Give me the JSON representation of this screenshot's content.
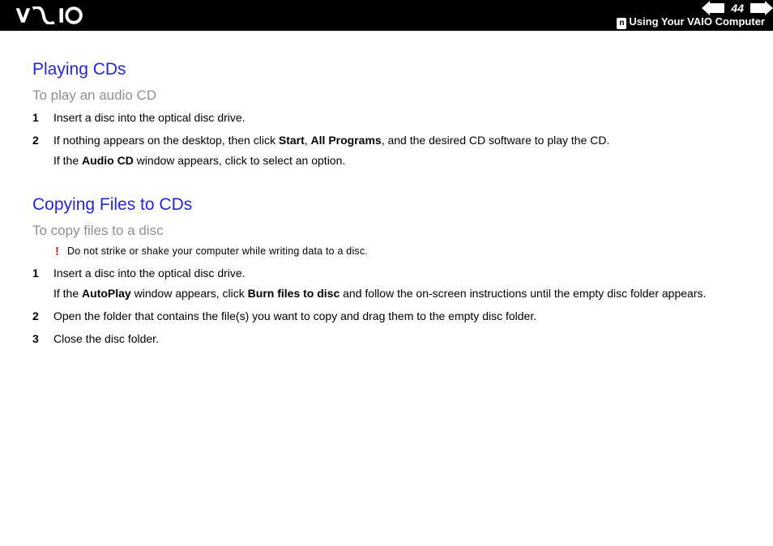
{
  "header": {
    "page_number": "44",
    "breadcrumb": "Using Your VAIO Computer"
  },
  "section1": {
    "title": "Playing CDs",
    "subtitle": "To play an audio CD",
    "steps": {
      "s1": "Insert a disc into the optical disc drive.",
      "s2a": "If nothing appears on the desktop, then click ",
      "s2b": "Start",
      "s2c": ", ",
      "s2d": "All Programs",
      "s2e": ", and the desired CD software to play the CD.",
      "s2f": "If the ",
      "s2g": "Audio CD",
      "s2h": " window appears, click to select an option."
    }
  },
  "section2": {
    "title": "Copying Files to CDs",
    "subtitle": "To copy files to a disc",
    "warning": "Do not strike or shake your computer while writing data to a disc.",
    "steps": {
      "s1a": "Insert a disc into the optical disc drive.",
      "s1b": "If the ",
      "s1c": "AutoPlay",
      "s1d": " window appears, click ",
      "s1e": "Burn files to disc",
      "s1f": " and follow the on-screen instructions until the empty disc folder appears.",
      "s2": "Open the folder that contains the file(s) you want to copy and drag them to the empty disc folder.",
      "s3": "Close the disc folder."
    }
  },
  "labels": {
    "n1": "1",
    "n2": "2",
    "n3": "3",
    "bang": "!"
  }
}
